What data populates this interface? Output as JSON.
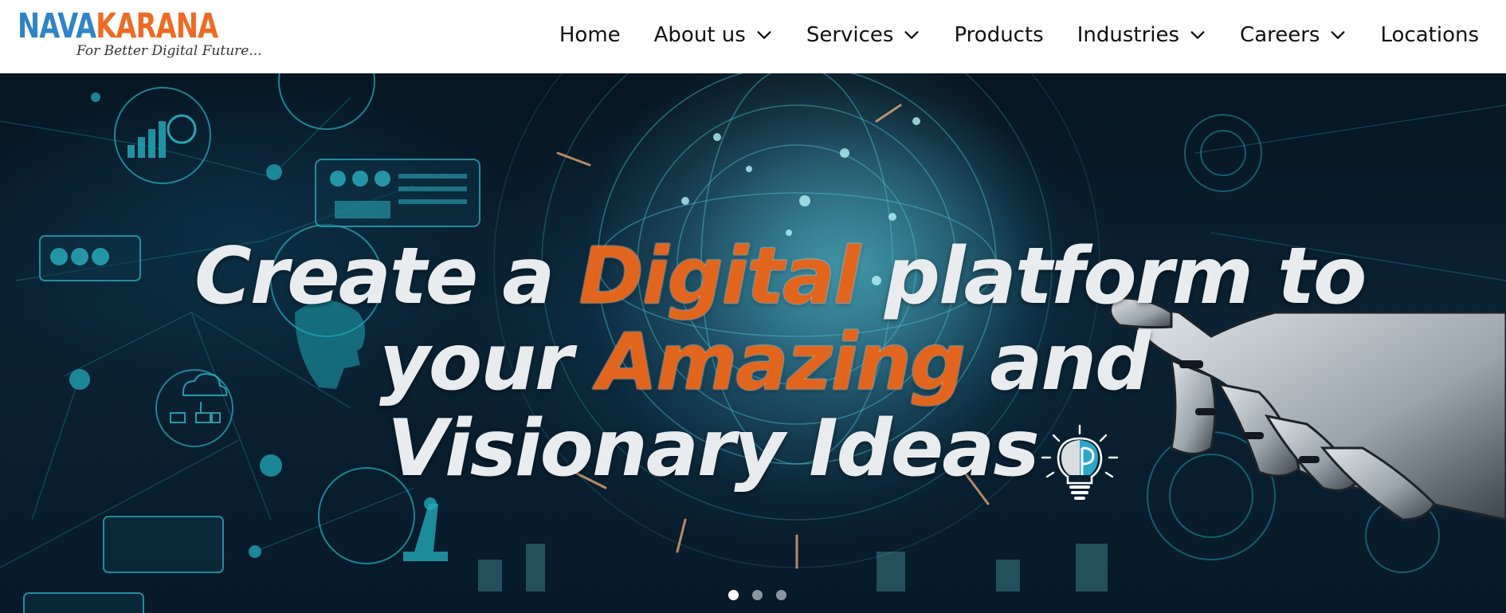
{
  "logo": {
    "brand_part1": "NAVA",
    "brand_part2": "KARANA",
    "tagline": "For Better Digital Future..."
  },
  "nav": {
    "items": [
      {
        "label": "Home",
        "has_dropdown": false
      },
      {
        "label": "About us",
        "has_dropdown": true
      },
      {
        "label": "Services",
        "has_dropdown": true
      },
      {
        "label": "Products",
        "has_dropdown": false
      },
      {
        "label": "Industries",
        "has_dropdown": true
      },
      {
        "label": "Careers",
        "has_dropdown": true
      },
      {
        "label": "Locations",
        "has_dropdown": false
      }
    ]
  },
  "hero": {
    "line1_a": "Create a ",
    "line1_accent": "Digital",
    "line1_b": " platform to",
    "line2_a": "your ",
    "line2_accent": "Amazing",
    "line2_b": " and",
    "line3": "Visionary Ideas",
    "icons": [
      "lightbulb-brain-icon",
      "robot-hand-image"
    ],
    "slides_total": 3,
    "slide_active": 1
  },
  "colors": {
    "brand_blue": "#2f84c8",
    "brand_orange": "#ef6a24",
    "accent_text": "#e2651d",
    "hero_text": "#e8ecef",
    "hero_bg": "#0a2233"
  }
}
